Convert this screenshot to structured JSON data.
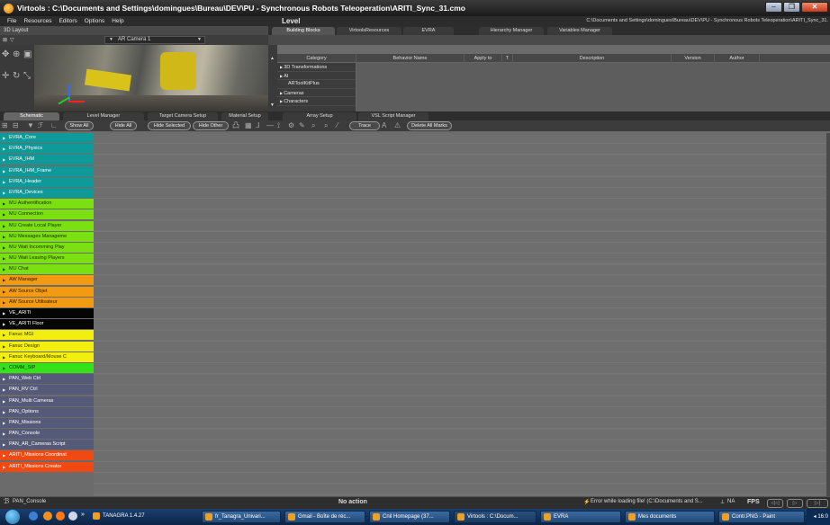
{
  "window": {
    "title": "Virtools : C:\\Documents and Settings\\domingues\\Bureau\\DEV\\PU - Synchronous Robots Teleoperation\\ARITI_Sync_31.cmo",
    "controls": [
      "–",
      "❐",
      "✕"
    ]
  },
  "menu": {
    "items": [
      "File",
      "Resources",
      "Editors",
      "Options",
      "Help"
    ],
    "level_label": "Level",
    "path": "C:\\Documents and Settings\\domingues\\Bureau\\DEV\\PU - Synchronous Robots Teleoperation\\ARITI_Sync_31."
  },
  "layout_panel": {
    "header": "3D Layout",
    "camera": "AR Camera 1"
  },
  "building_blocks": {
    "tabs": [
      "Building Blocks",
      "VirtoolsResources",
      "EVRA",
      "Hierarchy Manager",
      "Variables Manager"
    ],
    "columns": [
      "Category",
      "Behavior Name",
      "Apply to",
      "T",
      "Description",
      "Version",
      "Author"
    ],
    "categories": [
      "3D Transformations",
      "AI",
      "ARToolKitPlus",
      "Cameras",
      "Characters"
    ]
  },
  "schematic": {
    "tabs": [
      "Schematic",
      "Level Manager",
      "Target Camera Setup",
      "Material Setup",
      "Array Setup",
      "VSL Script Manager"
    ],
    "buttons": [
      "Show All",
      "Hide All",
      "Hide Selected",
      "Hide Other",
      "Trace",
      "Delete All Marks"
    ],
    "scripts": [
      {
        "name": "EVRA_Core",
        "bg": "#0f9a9a",
        "fg": "#ffffff"
      },
      {
        "name": "EVRA_Physics",
        "bg": "#0f9a9a",
        "fg": "#ffffff"
      },
      {
        "name": "EVRA_IHM",
        "bg": "#0f9a9a",
        "fg": "#ffffff"
      },
      {
        "name": "EVRA_IHM_Frame",
        "bg": "#0f9a9a",
        "fg": "#ffffff"
      },
      {
        "name": "EVRA_Header",
        "bg": "#0f9a9a",
        "fg": "#ffffff"
      },
      {
        "name": "EVRA_Devices",
        "bg": "#0f9a9a",
        "fg": "#ffffff"
      },
      {
        "name": "MU Authentification",
        "bg": "#7be012",
        "fg": "#1a2a00"
      },
      {
        "name": "MU Connection",
        "bg": "#7be012",
        "fg": "#1a2a00"
      },
      {
        "name": "MU Create Local Player",
        "bg": "#7be012",
        "fg": "#1a2a00"
      },
      {
        "name": "MU Messages Manageme",
        "bg": "#7be012",
        "fg": "#1a2a00"
      },
      {
        "name": "MU Wait Incomming Play",
        "bg": "#7be012",
        "fg": "#1a2a00"
      },
      {
        "name": "MU Wait Leaving Players",
        "bg": "#7be012",
        "fg": "#1a2a00"
      },
      {
        "name": "MU Chat",
        "bg": "#7be012",
        "fg": "#1a2a00"
      },
      {
        "name": "AW Manager",
        "bg": "#f29a12",
        "fg": "#2b1600"
      },
      {
        "name": "AW Source Objet",
        "bg": "#f29a12",
        "fg": "#2b1600"
      },
      {
        "name": "AW Source Utilisateur",
        "bg": "#f29a12",
        "fg": "#2b1600"
      },
      {
        "name": "VE_ARITI",
        "bg": "#050505",
        "fg": "#ffffff"
      },
      {
        "name": "VE_ARITI Floor",
        "bg": "#050505",
        "fg": "#ffffff"
      },
      {
        "name": "Fanuc MGI",
        "bg": "#f2ee10",
        "fg": "#3a3000"
      },
      {
        "name": "Fanuc Design",
        "bg": "#f2ee10",
        "fg": "#3a3000"
      },
      {
        "name": "Fanuc Keyboard/Mouse C",
        "bg": "#f2ee10",
        "fg": "#3a3000"
      },
      {
        "name": "COMM_SIP",
        "bg": "#35e21a",
        "fg": "#0a2a00"
      },
      {
        "name": "PAN_Web Ctrl",
        "bg": "#545a78",
        "fg": "#ffffff"
      },
      {
        "name": "PAN_RV Ctrl",
        "bg": "#545a78",
        "fg": "#ffffff"
      },
      {
        "name": "PAN_Multi Cameras",
        "bg": "#545a78",
        "fg": "#ffffff"
      },
      {
        "name": "PAN_Options",
        "bg": "#545a78",
        "fg": "#ffffff"
      },
      {
        "name": "PAN_Missions",
        "bg": "#545a78",
        "fg": "#ffffff"
      },
      {
        "name": "PAN_Console",
        "bg": "#545a78",
        "fg": "#ffffff"
      },
      {
        "name": "PAN_AR_Cameras Script",
        "bg": "#545a78",
        "fg": "#ffffff"
      },
      {
        "name": "ARITI_Missions Coordinat",
        "bg": "#f04a12",
        "fg": "#ffffff"
      },
      {
        "name": "ARITI_Missions Creator",
        "bg": "#f04a12",
        "fg": "#ffffff"
      }
    ]
  },
  "status": {
    "selected": "PAN_Console",
    "action": "No action",
    "error": "Error while loading file! (C:\\Documents and S...",
    "na": "NA",
    "fps": "FPS"
  },
  "taskbar": {
    "items": [
      "TANAGRA 1.4.27",
      "fr_Tanagra_Univari...",
      "Gmail - Boîte de réc...",
      "Cnil Homepage (37...",
      "Virtools : C:\\Docum...",
      "EVRA",
      "Mes documents",
      "Contr.PNG - Paint"
    ],
    "clock": "16:0"
  }
}
